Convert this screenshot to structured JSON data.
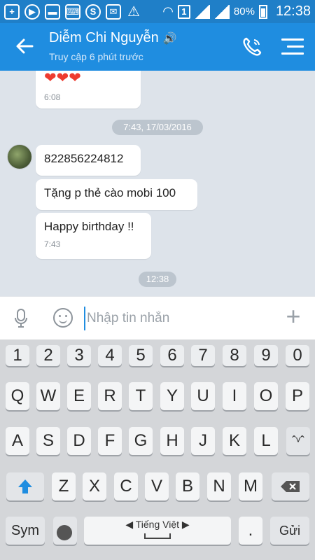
{
  "status_bar": {
    "battery_text": "80%",
    "sim_label": "1",
    "time": "12:38"
  },
  "header": {
    "contact_name": "Diễm Chi Nguyễn",
    "last_seen": "Truy cập 6 phút trước"
  },
  "chat": {
    "messages": [
      {
        "text": "❤❤❤",
        "time": "6:08"
      },
      {
        "text": "822856224812",
        "time": ""
      },
      {
        "text": "Tặng p thẻ cào mobi 100",
        "time": ""
      },
      {
        "text": "Happy birthday !!",
        "time": "7:43"
      }
    ],
    "separators": [
      "7:43, 17/03/2016",
      "12:38"
    ]
  },
  "composer": {
    "placeholder": "Nhập tin nhắn",
    "value": ""
  },
  "keyboard": {
    "numbers": [
      "1",
      "2",
      "3",
      "4",
      "5",
      "6",
      "7",
      "8",
      "9",
      "0"
    ],
    "row_q": [
      "Q",
      "W",
      "E",
      "R",
      "T",
      "Y",
      "U",
      "I",
      "O",
      "P"
    ],
    "row_a": [
      "A",
      "S",
      "D",
      "F",
      "G",
      "H",
      "J",
      "K",
      "L"
    ],
    "row_z": [
      "Z",
      "X",
      "C",
      "V",
      "B",
      "N",
      "M"
    ],
    "sym_label": "Sym",
    "language_label": "◀  Tiếng Việt  ▶",
    "dot_label": ".",
    "send_label": "Gửi",
    "lang_switch_label": "ˆᵛˆ"
  },
  "colors": {
    "header_blue": "#1f8de0",
    "chat_bg": "#dde3ea",
    "keyboard_bg": "#d4d6d9"
  }
}
